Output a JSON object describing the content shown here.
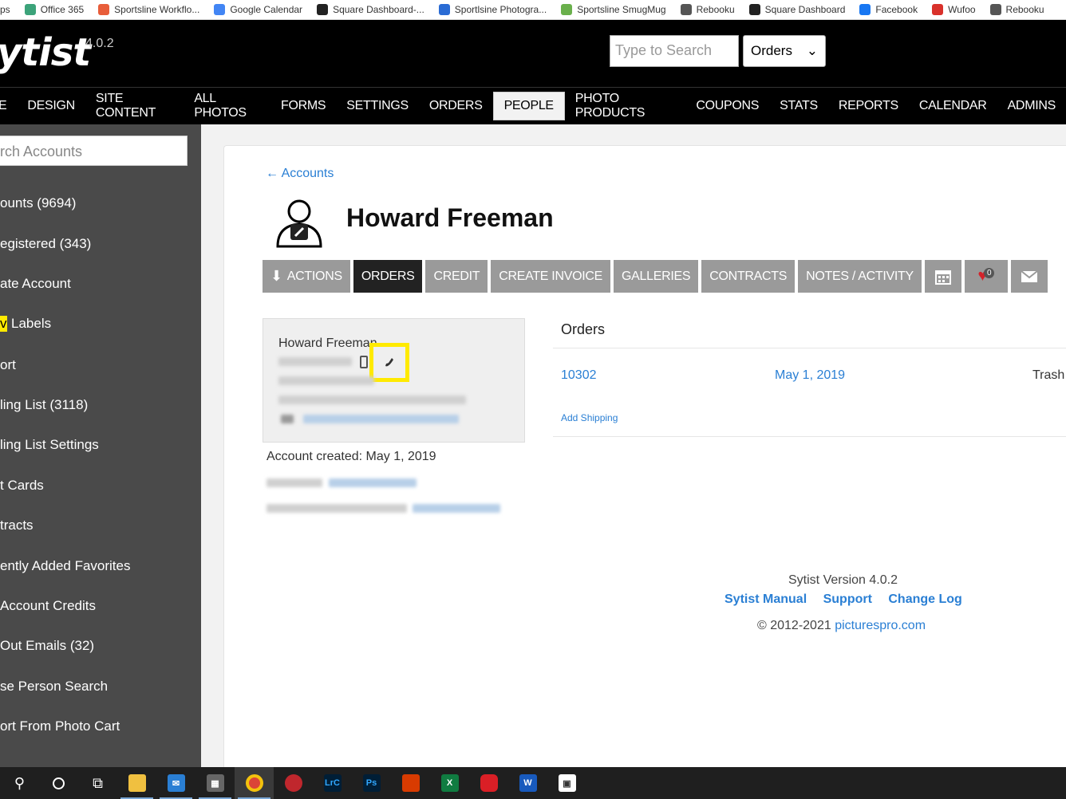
{
  "bookmarks": [
    {
      "label": "ps",
      "color": "#ffffff"
    },
    {
      "label": "Office 365",
      "color": "#3ca37a"
    },
    {
      "label": "Sportsline Workflo...",
      "color": "#e85d3a"
    },
    {
      "label": "Google Calendar",
      "color": "#4285f4"
    },
    {
      "label": "Square Dashboard-...",
      "color": "#222222"
    },
    {
      "label": "Sportlsine Photogra...",
      "color": "#2a6bd4"
    },
    {
      "label": "Sportsline SmugMug",
      "color": "#6ab04c"
    },
    {
      "label": "Rebooku",
      "color": "#555555"
    },
    {
      "label": "Square Dashboard",
      "color": "#222222"
    },
    {
      "label": "Facebook",
      "color": "#1877f2"
    },
    {
      "label": "Wufoo",
      "color": "#d9312b"
    },
    {
      "label": "Rebooku",
      "color": "#555555"
    }
  ],
  "header": {
    "logo": "ytist",
    "version": "4.0.2",
    "search_placeholder": "Type to Search",
    "search_scope": "Orders"
  },
  "nav": [
    "E",
    "DESIGN",
    "SITE CONTENT",
    "ALL PHOTOS",
    "FORMS",
    "SETTINGS",
    "ORDERS",
    "PEOPLE",
    "PHOTO PRODUCTS",
    "COUPONS",
    "STATS",
    "REPORTS",
    "CALENDAR",
    "ADMINS"
  ],
  "sidebar": {
    "search_placeholder": "rch Accounts",
    "items": [
      "ounts (9694)",
      "egistered (343)",
      "ate Account",
      "Labels",
      "ort",
      "ling List (3118)",
      "ling List Settings",
      "t Cards",
      "tracts",
      "ently Added Favorites",
      "Account Credits",
      "Out Emails (32)",
      "se Person Search",
      "ort From Photo Cart"
    ],
    "labels_badge": "v"
  },
  "account": {
    "back_link": "← Accounts",
    "name": "Howard Freeman",
    "tabs": [
      "ACTIONS",
      "ORDERS",
      "CREDIT",
      "CREATE INVOICE",
      "GALLERIES",
      "CONTRACTS",
      "NOTES / ACTIVITY"
    ],
    "favorites_count": "0",
    "info_name": "Howard Freeman",
    "created": "Account created: May 1, 2019"
  },
  "orders": {
    "title": "Orders",
    "rows": [
      {
        "number": "10302",
        "date": "May 1, 2019",
        "action": "Trash",
        "link": "Add Shipping"
      }
    ]
  },
  "footer": {
    "version": "Sytist Version 4.0.2",
    "links": [
      "Sytist Manual",
      "Support",
      "Change Log"
    ],
    "copyright": "© 2012-2021 ",
    "site": "picturespro.com"
  },
  "colors": {
    "accent": "#2a7fd4",
    "highlight": "#ffea00",
    "sidebar": "#4a4a4a"
  }
}
